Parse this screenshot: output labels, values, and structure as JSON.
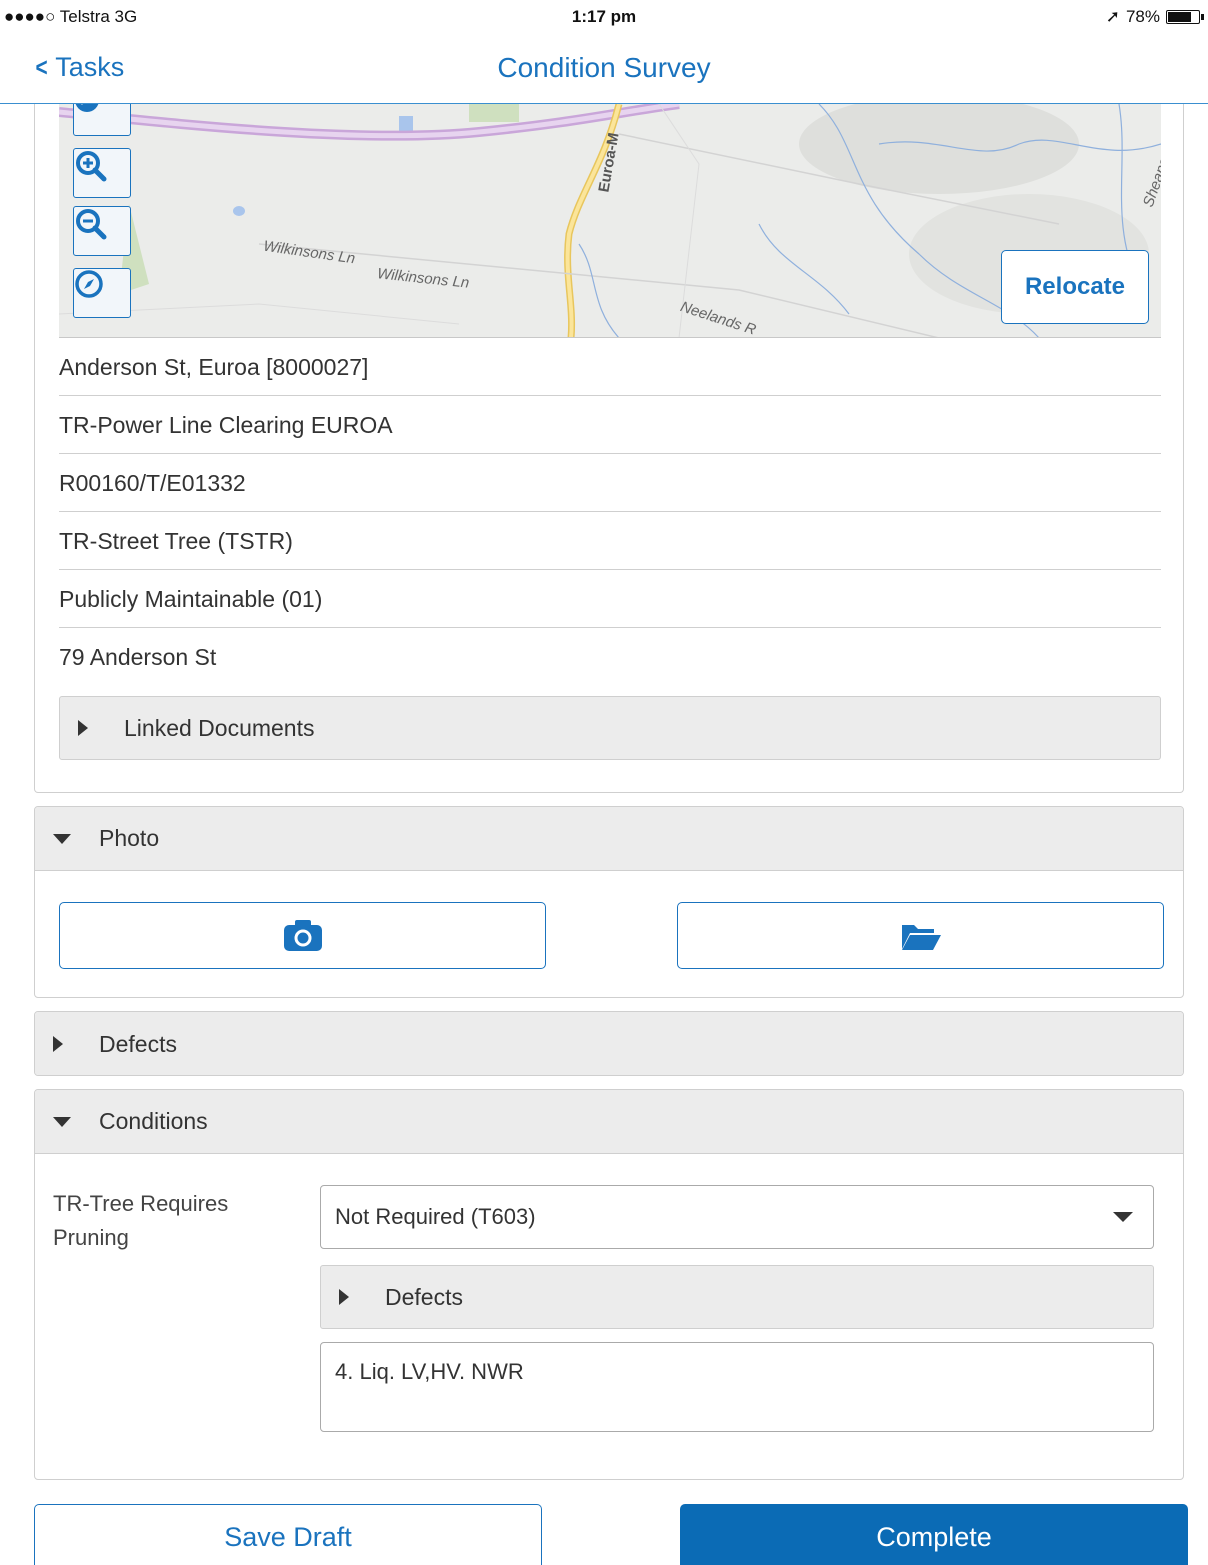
{
  "status_bar": {
    "carrier": "●●●●○ Telstra  3G",
    "time": "1:17 pm",
    "battery": "78%",
    "battery_level": 0.78
  },
  "nav": {
    "back_label": "Tasks",
    "title": "Condition Survey"
  },
  "map": {
    "labels": {
      "road_a": "Wilkinsons Ln",
      "road_b": "Wilkinsons Ln",
      "road_c": "Euroa-M",
      "road_d": "Neelands R",
      "road_e": "Sheans"
    },
    "relocate_label": "Relocate"
  },
  "details": {
    "rows": [
      "Anderson St, Euroa [8000027]",
      "TR-Power Line Clearing EUROA",
      "R00160/T/E01332",
      "TR-Street Tree (TSTR)",
      "Publicly Maintainable (01)",
      "79 Anderson St"
    ],
    "linked_documents": "Linked Documents"
  },
  "photo": {
    "header": "Photo"
  },
  "defects": {
    "header": "Defects"
  },
  "conditions": {
    "header": "Conditions",
    "field_label": "TR-Tree Requires Pruning",
    "selected_value": "Not Required (T603)",
    "defects_label": "Defects",
    "note": "4. Liq. LV,HV. NWR"
  },
  "actions": {
    "save_draft": "Save Draft",
    "complete": "Complete"
  },
  "colors": {
    "accent": "#1a73be",
    "primary_button": "#0b6bb5",
    "panel_header": "#ececec"
  }
}
